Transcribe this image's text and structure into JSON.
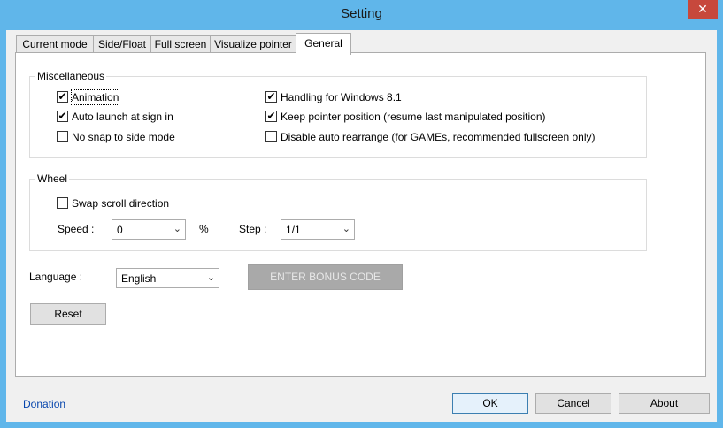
{
  "window": {
    "title": "Setting",
    "close_glyph": "✕"
  },
  "tabs": [
    {
      "label": "Current mode"
    },
    {
      "label": "Side/Float"
    },
    {
      "label": "Full screen"
    },
    {
      "label": "Visualize pointer"
    },
    {
      "label": "General"
    }
  ],
  "miscellaneous": {
    "title": "Miscellaneous",
    "animation": {
      "label": "Animation",
      "checked": true
    },
    "auto_launch": {
      "label": "Auto launch at sign in",
      "checked": true
    },
    "no_snap": {
      "label": "No snap to side mode",
      "checked": false
    },
    "handling_win81": {
      "label": "Handling for Windows 8.1",
      "checked": true
    },
    "keep_pointer": {
      "label": "Keep pointer position (resume last manipulated position)",
      "checked": true
    },
    "disable_rearrange": {
      "label": "Disable auto rearrange (for GAMEs, recommended fullscreen only)",
      "checked": false
    }
  },
  "wheel": {
    "title": "Wheel",
    "swap_scroll": {
      "label": "Swap scroll direction",
      "checked": false
    },
    "speed_label": "Speed :",
    "speed_value": "0",
    "percent": "%",
    "step_label": "Step :",
    "step_value": "1/1"
  },
  "language": {
    "label": "Language :",
    "value": "English"
  },
  "bonus_button": "ENTER BONUS CODE",
  "reset_button": "Reset",
  "footer": {
    "donation": "Donation",
    "ok": "OK",
    "cancel": "Cancel",
    "about": "About"
  },
  "check_glyph": "✔",
  "dropdown_glyph": "⌄"
}
